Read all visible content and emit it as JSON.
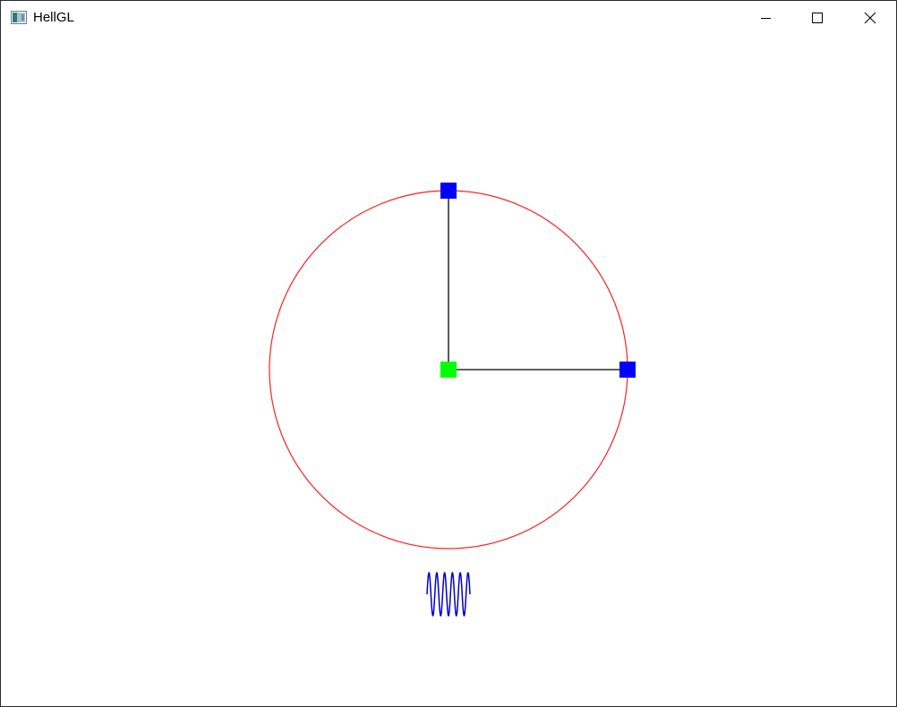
{
  "window": {
    "title": "HellGL",
    "icon": "opengl-window-icon",
    "controls": [
      "minimize-icon",
      "maximize-icon",
      "close-icon"
    ]
  },
  "scene": {
    "colors": {
      "circle": "#ff2020",
      "center_point": "#00ff00",
      "handle_points": "#0000ff",
      "radius_lines": "#000000",
      "wave": "#0000cc"
    }
  }
}
